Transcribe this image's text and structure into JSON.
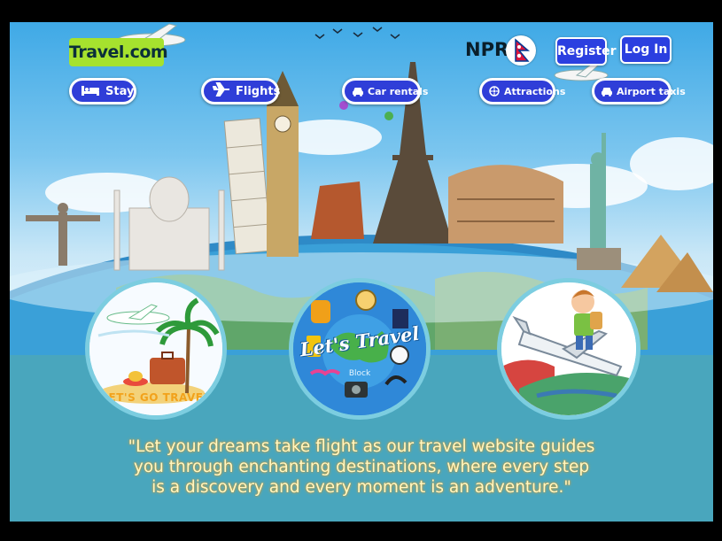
{
  "brand": {
    "logo_text": "Travel.com"
  },
  "header": {
    "currency": "NPR",
    "register_label": "Register",
    "login_label": "Log In"
  },
  "nav": {
    "items": [
      {
        "label": "Stay",
        "icon": "bed-icon"
      },
      {
        "label": "Flights",
        "icon": "airplane-icon"
      },
      {
        "label": "Car rentals",
        "icon": "car-icon"
      },
      {
        "label": "Attractions",
        "icon": "attractions-icon"
      },
      {
        "label": "Airport taxis",
        "icon": "taxi-icon"
      }
    ]
  },
  "cards": {
    "left_caption": "LET'S GO TRAVEL",
    "center_title": "Let's Travel",
    "center_sub": "Block"
  },
  "quote": {
    "line1": "\"Let your dreams take flight as our travel website guides",
    "line2": "you through enchanting destinations, where every step",
    "line3": "is a discovery and every moment is an adventure.\""
  },
  "colors": {
    "nav_bg": "#2f3ed8",
    "logo_bg": "#a6e22e",
    "panel_bg": "#49a6bd",
    "quote_text": "#fff9c4"
  }
}
